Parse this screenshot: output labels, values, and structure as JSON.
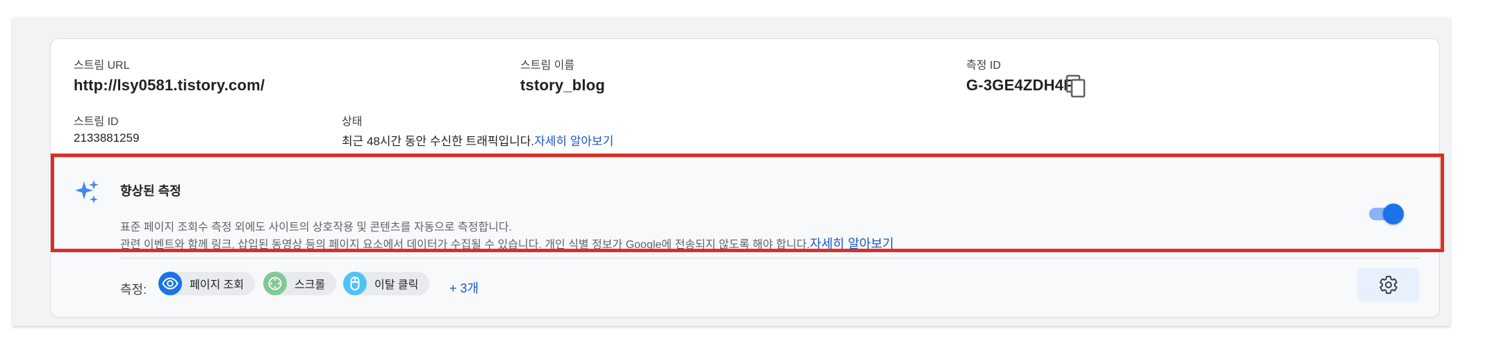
{
  "stream": {
    "url_label": "스트림 URL",
    "url_value": "http://lsy0581.tistory.com/",
    "name_label": "스트림 이름",
    "name_value": "tstory_blog",
    "measurement_id_label": "측정 ID",
    "measurement_id_value": "G-3GE4ZDH4F3",
    "copy_icon": "copy-icon",
    "stream_id_label": "스트림 ID",
    "stream_id_value": "2133881259",
    "status_label": "상태",
    "status_text": "최근 48시간 동안 수신한 트래픽입니다.",
    "status_link": "자세히 알아보기"
  },
  "enhanced": {
    "icon": "sparkle-icon",
    "title": "향상된 측정",
    "desc_line1": "표준 페이지 조회수 측정 외에도 사이트의 상호작용 및 콘텐츠를 자동으로 측정합니다.",
    "desc_line2": "관련 이벤트와 함께 링크, 삽입된 동영상 등의 페이지 요소에서 데이터가 수집될 수 있습니다. 개인 식별 정보가 Google에 전송되지 않도록 해야 합니다.",
    "desc_link": "자세히 알아보기",
    "toggle_on": true,
    "highlight_color": "#d93025"
  },
  "measurements": {
    "label": "측정:",
    "chips": [
      {
        "label": "페이지 조회",
        "icon": "eye-icon",
        "color": "#1a73e8"
      },
      {
        "label": "스크롤",
        "icon": "scroll-arrows-icon",
        "color": "#81c995"
      },
      {
        "label": "이탈 클릭",
        "icon": "mouse-icon",
        "color": "#4fc3f7"
      }
    ],
    "more": "+ 3개",
    "settings_icon": "gear-icon"
  },
  "colors": {
    "accent": "#1a73e8",
    "link": "#1a56c9",
    "highlight": "#d93025"
  }
}
